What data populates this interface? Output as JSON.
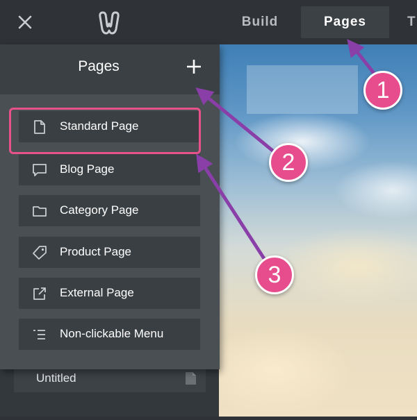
{
  "topbar": {
    "tabs": [
      {
        "label": "Build",
        "active": false
      },
      {
        "label": "Pages",
        "active": true
      },
      {
        "label": "T",
        "active": false
      }
    ]
  },
  "panel": {
    "title": "Pages",
    "add_icon": "plus-icon",
    "items": [
      {
        "label": "Standard Page",
        "icon": "page-icon",
        "highlighted": true
      },
      {
        "label": "Blog Page",
        "icon": "speech-bubble-icon"
      },
      {
        "label": "Category Page",
        "icon": "folder-icon"
      },
      {
        "label": "Product Page",
        "icon": "tag-icon"
      },
      {
        "label": "External Page",
        "icon": "external-link-icon"
      },
      {
        "label": "Non-clickable Menu",
        "icon": "menu-lines-icon"
      }
    ]
  },
  "sidebar": {
    "existing_page": {
      "label": "Untitled",
      "icon": "page-icon"
    }
  },
  "annotations": {
    "badges": [
      "1",
      "2",
      "3"
    ],
    "badge_color": "#e74d8c",
    "arrow_color": "#8a3fa8",
    "highlight_color": "#e8518a"
  },
  "colors": {
    "topbar": "#2f3337",
    "panel": "#4a4f53",
    "item": "#3a3f43"
  }
}
